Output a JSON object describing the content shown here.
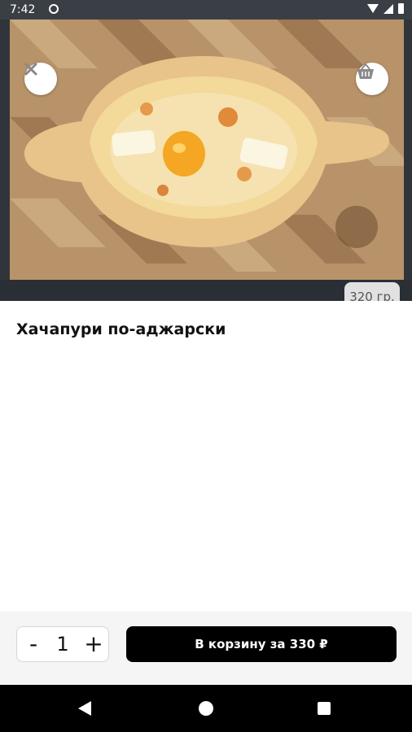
{
  "status_bar": {
    "time": "7:42"
  },
  "product": {
    "title": "Хачапури по-аджарски",
    "weight": "320 гр."
  },
  "actions": {
    "close_glyph": "✕",
    "basket_icon": "basket-icon"
  },
  "quantity": {
    "minus": "-",
    "value": "1",
    "plus": "+"
  },
  "cart_button": {
    "label": "В корзину за 330 ₽"
  },
  "colors": {
    "accent": "#000000",
    "bottom_bar": "#f5f5f5",
    "status_bar": "#3a3f45"
  }
}
